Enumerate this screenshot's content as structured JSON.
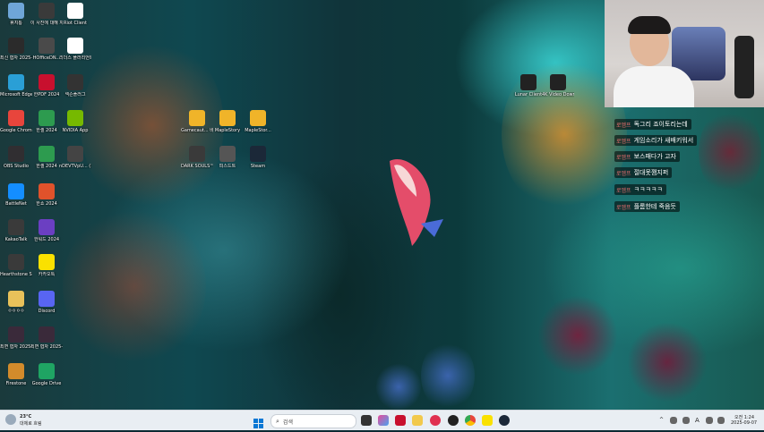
{
  "desktop_icons": [
    {
      "label": "휴지통",
      "icon": "recycle-bin-icon",
      "color": "#6fa6d8"
    },
    {
      "label": "이 사진에 대해 자세...",
      "icon": "info-camera-icon",
      "color": "#3a3a3a"
    },
    {
      "label": "Riot Client",
      "icon": "file-icon",
      "color": "#ffffff"
    },
    {
      "label": "최신 협자 2025-06-...",
      "icon": "folder-icon",
      "color": "#2b2b2b"
    },
    {
      "label": "HOfficeDN...",
      "icon": "hoffice-icon",
      "color": "#4a4a4a"
    },
    {
      "label": "리더스 플러리언트",
      "icon": "file-icon",
      "color": "#ffffff"
    },
    {
      "label": "Microsoft Edge",
      "icon": "edge-icon",
      "color": "#2a9fd6"
    },
    {
      "label": "한PDF 2024",
      "icon": "pdf-icon",
      "color": "#c8102e"
    },
    {
      "label": "넥슨플러그",
      "icon": "nexon-icon",
      "color": "#333333"
    },
    {
      "label": "Google Chrome",
      "icon": "chrome-icon",
      "color": "#e8453c"
    },
    {
      "label": "한셀 2024",
      "icon": "hancell-icon",
      "color": "#2d9b4f"
    },
    {
      "label": "NVIDIA App",
      "icon": "nvidia-icon",
      "color": "#76b900"
    },
    {
      "label": "Gamecaut... 바로 가기",
      "icon": "gamecaut-icon",
      "color": "#f0b429"
    },
    {
      "label": "MapleStory",
      "icon": "maplestory-icon",
      "color": "#f0b429"
    },
    {
      "label": "MapleStor...",
      "icon": "maplestory-icon",
      "color": "#f0b429"
    },
    {
      "label": "OBS Studio",
      "icon": "obs-icon",
      "color": "#302e31"
    },
    {
      "label": "한셀 2024",
      "icon": "hancell-icon",
      "color": "#2d9b4f"
    },
    {
      "label": "nDEVTVpU... (1)",
      "icon": "app-icon",
      "color": "#444444"
    },
    {
      "label": "DARK SOULS™...",
      "icon": "darksouls-icon",
      "color": "#3a3a3a"
    },
    {
      "label": "피스드트",
      "icon": "app-icon",
      "color": "#555555"
    },
    {
      "label": "Steam",
      "icon": "steam-icon",
      "color": "#1b2838"
    },
    {
      "label": "BattleNet",
      "icon": "battlenet-icon",
      "color": "#148eff"
    },
    {
      "label": "한쇼 2024",
      "icon": "hanshow-icon",
      "color": "#e0522b"
    },
    {
      "label": "KakaoTalk",
      "icon": "kakaotalk-icon",
      "color": "#3a3a3a"
    },
    {
      "label": "한워드 2024",
      "icon": "hanword-icon",
      "color": "#6b3fc2"
    },
    {
      "label": "Hearthstone Screensho...",
      "icon": "hearthstone-icon",
      "color": "#3a3a3a"
    },
    {
      "label": "카카오톡",
      "icon": "kakaotalk-icon",
      "color": "#fae100"
    },
    {
      "label": "ㅇㅇㅇㅇ",
      "icon": "folder-icon",
      "color": "#e8c15a"
    },
    {
      "label": "Discord",
      "icon": "discord-icon",
      "color": "#5865f2"
    },
    {
      "label": "최면 협자 2025-09-...",
      "icon": "folder-icon",
      "color": "#3a2a3a"
    },
    {
      "label": "최면 협자 2025-09-...",
      "icon": "folder-icon",
      "color": "#3a2a3a"
    },
    {
      "label": "Firestone",
      "icon": "firestone-icon",
      "color": "#d38b2b"
    },
    {
      "label": "Google Drive",
      "icon": "drive-icon",
      "color": "#1fa463"
    },
    {
      "label": "Lunar Client",
      "icon": "lunar-icon",
      "color": "#222222"
    },
    {
      "label": "4K Video Downloader+",
      "icon": "4k-icon",
      "color": "#222222"
    }
  ],
  "chat": [
    {
      "tag": "로엠프",
      "msg": "독그리 죠이토리는데"
    },
    {
      "tag": "로엠프",
      "msg": "게임소리가 새배키워서"
    },
    {
      "tag": "로엠프",
      "msg": "보스패다가 고자"
    },
    {
      "tag": "로엠프",
      "msg": "절대못깸지퍼"
    },
    {
      "tag": "로엠프",
      "msg": "ㅋㅋㅋㅋㅋ"
    },
    {
      "tag": "로엠프",
      "msg": "플롬한테 죽음듯"
    }
  ],
  "taskbar": {
    "weather_temp": "23°C",
    "weather_desc": "대체로 흐림",
    "search_placeholder": "검색",
    "time": "오전 1:24",
    "date": "2025-09-07",
    "tray_lang": "A"
  },
  "colors": {
    "taskbar_bg": "#e9eef3",
    "chat_tag": "#f07070"
  }
}
